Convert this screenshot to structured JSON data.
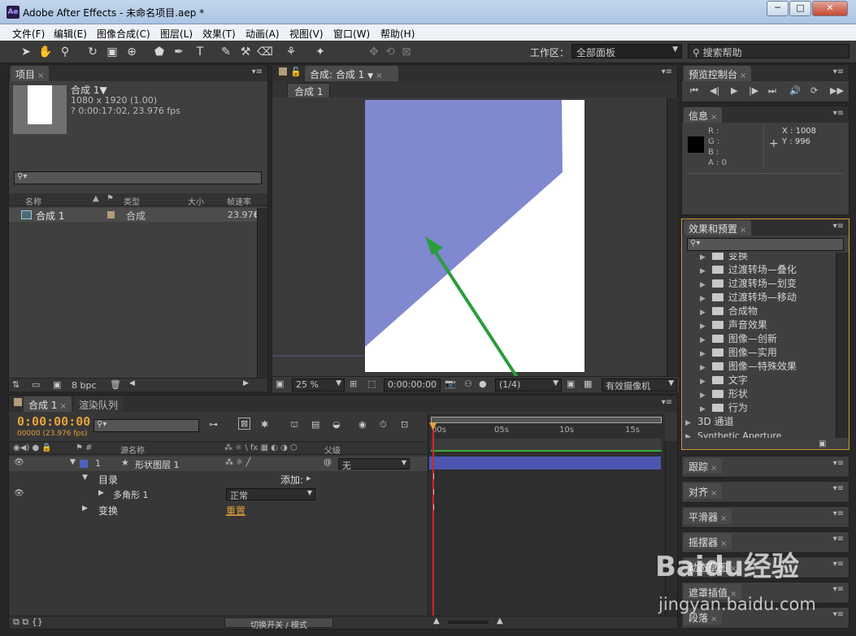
{
  "window": {
    "title": "Adobe After Effects - 未命名项目.aep *",
    "logo": "Ae",
    "min": "─",
    "max": "□",
    "close": "✕"
  },
  "menu": [
    "文件(F)",
    "编辑(E)",
    "图像合成(C)",
    "图层(L)",
    "效果(T)",
    "动画(A)",
    "视图(V)",
    "窗口(W)",
    "帮助(H)"
  ],
  "toolbar": {
    "workspace_label": "工作区：",
    "workspace_value": "全部面板",
    "search_help": "搜索帮助"
  },
  "project": {
    "tab": "项目",
    "comp_name": "合成 1▼",
    "comp_size": "1080 x 1920 (1.00)",
    "comp_duration": "? 0:00:17:02, 23.976 fps",
    "columns": [
      "名称",
      "类型",
      "大小",
      "帧速率"
    ],
    "item_name": "合成 1",
    "item_type": "合成",
    "item_fps": "23.976",
    "bpc": "8 bpc"
  },
  "composition": {
    "tab": "合成: 合成 1",
    "sub_tab": "合成 1",
    "zoom": "25 %",
    "timecode": "0:00:00:00",
    "resolution": "(1/4)",
    "camera": "有效摄像机",
    "shape_color": "#8088cf"
  },
  "preview": {
    "tab": "预览控制台"
  },
  "info": {
    "tab": "信息",
    "r": "R :",
    "g": "G :",
    "b": "B :",
    "a": "A : 0",
    "x": "X : 1008",
    "y": "Y : 996"
  },
  "effects": {
    "tab": "效果和预置",
    "items": [
      "变换",
      "过渡转场—叠化",
      "过渡转场—划变",
      "过渡转场—移动",
      "合成物",
      "声音效果",
      "图像—创新",
      "图像—实用",
      "图像—特殊效果",
      "文字",
      "形状",
      "行为"
    ],
    "top_items": [
      "3D 通道",
      "Synthetic Aperture"
    ]
  },
  "side_panels": [
    "跟踪",
    "对齐",
    "平滑器",
    "摇摆器",
    "动态草图",
    "遮罩插值",
    "段落"
  ],
  "timeline": {
    "tab": "合成 1",
    "render_tab": "渲染队列",
    "timecode": "0:00:00:00",
    "frame_info": "00000 (23.976 fps)",
    "ruler": [
      "00s",
      "05s",
      "10s",
      "15s"
    ],
    "col_source": "源名称",
    "col_parent": "父级",
    "layer_num": "1",
    "layer_name": "形状图层 1",
    "parent_value": "无",
    "contents": "目录",
    "add_label": "添加:",
    "polygon": "多角形 1",
    "blend_mode": "正常",
    "transform": "变换",
    "reset": "重置",
    "switch_mode": "切换开关 / 模式"
  },
  "watermark": {
    "text": "Baidu经验",
    "url": "jingyan.baidu.com"
  }
}
